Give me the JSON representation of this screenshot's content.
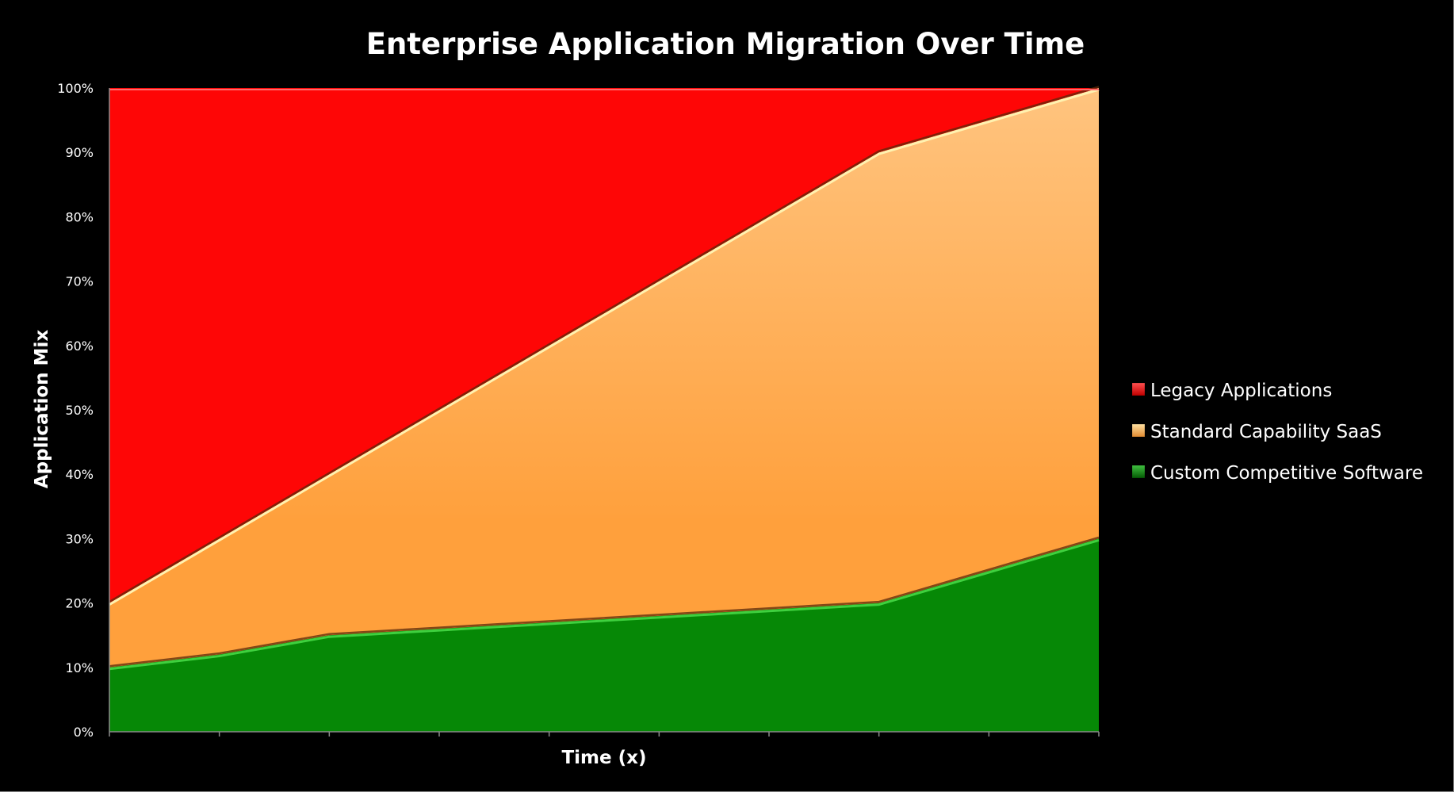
{
  "chart_data": {
    "type": "area",
    "stacked": true,
    "percent_stacked": true,
    "title": "Enterprise Application Migration Over Time",
    "xlabel": "Time (x)",
    "ylabel": "Application Mix",
    "x": [
      1,
      2,
      3,
      4,
      5,
      6,
      7,
      8,
      9,
      10
    ],
    "x_tick_labels_shown": false,
    "ylim": [
      0,
      100
    ],
    "y_ticks": [
      0,
      10,
      20,
      30,
      40,
      50,
      60,
      70,
      80,
      90,
      100
    ],
    "y_tick_labels": [
      "0%",
      "10%",
      "20%",
      "30%",
      "40%",
      "50%",
      "60%",
      "70%",
      "80%",
      "90%",
      "100%"
    ],
    "grid": false,
    "legend_position": "right",
    "series": [
      {
        "name": "Custom Competitive Software",
        "color": "#068806",
        "highlight": "#3fd03f",
        "values": [
          10,
          12,
          15,
          16,
          17,
          18,
          19,
          20,
          25,
          30
        ]
      },
      {
        "name": "Standard Capability SaaS",
        "color": "#ffa03c",
        "color_top": "#ffc27e",
        "highlight": "#fff2b0",
        "values": [
          10,
          18,
          25,
          34,
          43,
          52,
          61,
          70,
          70,
          70
        ]
      },
      {
        "name": "Legacy Applications",
        "color": "#fe0606",
        "highlight": "#ff6a6a",
        "values": [
          80,
          70,
          60,
          50,
          40,
          30,
          20,
          10,
          5,
          0
        ]
      }
    ],
    "legend_order": [
      "Legacy Applications",
      "Standard Capability SaaS",
      "Custom Competitive Software"
    ]
  }
}
